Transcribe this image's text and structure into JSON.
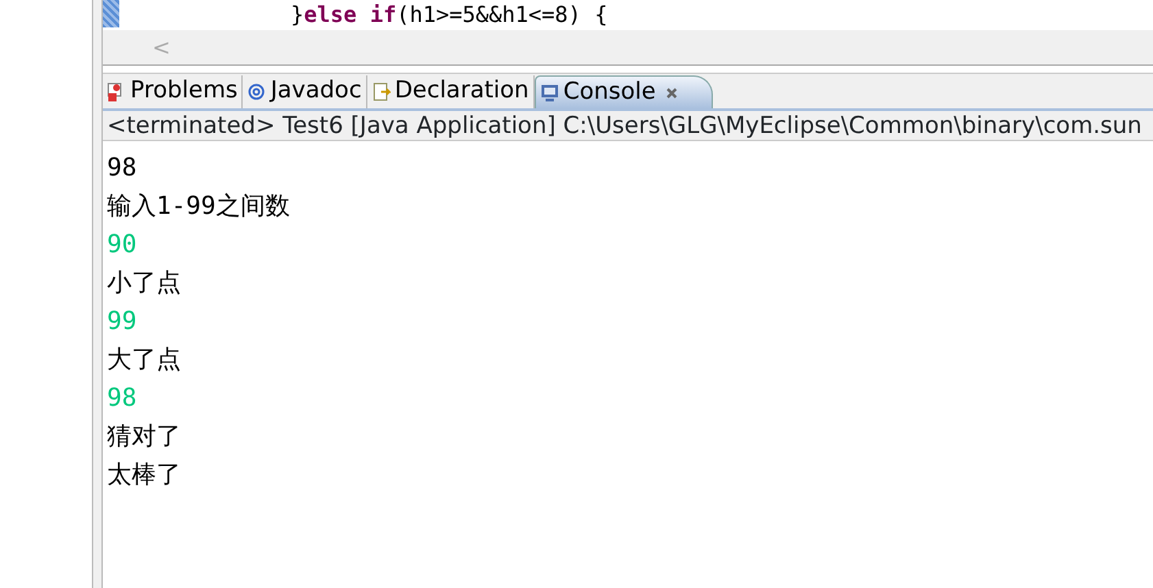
{
  "editor": {
    "code_line": "}**else** **if**(h1>=5&&h1<=8) {",
    "scroll_left": "<"
  },
  "tabs": [
    {
      "label": "Problems",
      "selected": false,
      "closable": false
    },
    {
      "label": "Javadoc",
      "selected": false,
      "closable": false
    },
    {
      "label": "Declaration",
      "selected": false,
      "closable": false
    },
    {
      "label": "Console",
      "selected": true,
      "closable": true
    }
  ],
  "console": {
    "header": "<terminated> Test6 [Java Application] C:\\Users\\GLG\\MyEclipse\\Common\\binary\\com.sun",
    "lines": [
      {
        "text": "98",
        "kind": "output"
      },
      {
        "text": "输入1-99之间数",
        "kind": "output"
      },
      {
        "text": "90",
        "kind": "input"
      },
      {
        "text": "小了点",
        "kind": "output"
      },
      {
        "text": "99",
        "kind": "input"
      },
      {
        "text": "大了点",
        "kind": "output"
      },
      {
        "text": "98",
        "kind": "input"
      },
      {
        "text": "猜对了",
        "kind": "output"
      },
      {
        "text": "太棒了",
        "kind": "output"
      }
    ]
  }
}
